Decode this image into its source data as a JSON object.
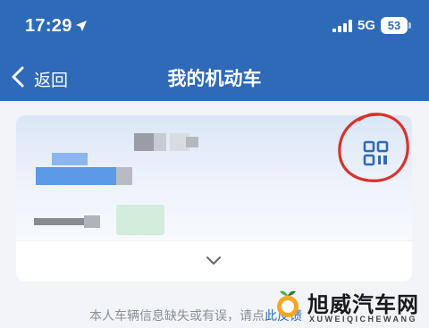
{
  "status_bar": {
    "time": "17:29",
    "network": "5G",
    "battery": "53"
  },
  "nav": {
    "back_label": "返回",
    "title": "我的机动车"
  },
  "card": {
    "qr_icon": "qr-code-icon",
    "expand_icon": "chevron-down-icon",
    "annotation_color": "#d8322c"
  },
  "footer": {
    "text_prefix": "本人车辆信息缺失或有误，请点",
    "link_text": "此反馈"
  },
  "watermark": {
    "name": "旭威汽车网",
    "sub": "XUWEIQICHEWANG"
  },
  "colors": {
    "brand": "#2e6ab8",
    "background": "#f2f4f7"
  }
}
